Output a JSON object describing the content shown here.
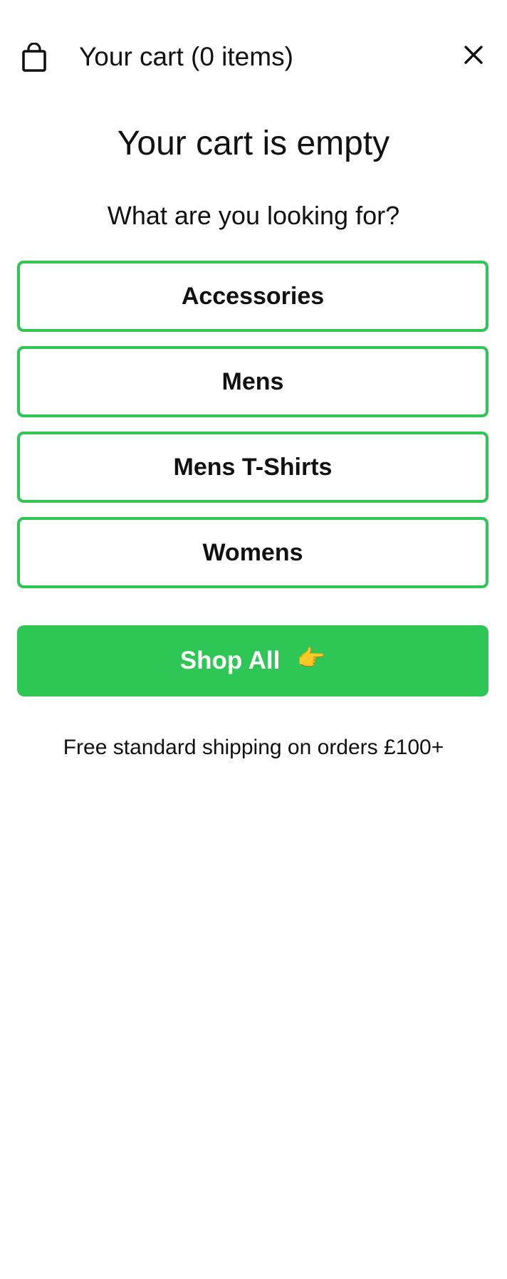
{
  "cart": {
    "title": "Your cart (0 items)",
    "empty_heading": "Your cart is empty",
    "prompt": "What are you looking for?",
    "categories": [
      {
        "label": "Accessories"
      },
      {
        "label": "Mens"
      },
      {
        "label": "Mens T-Shirts"
      },
      {
        "label": "Womens"
      }
    ],
    "shop_all_label": "Shop All",
    "shop_all_emoji": "👉",
    "shipping_note": "Free standard shipping on orders £100+"
  },
  "icons": {
    "bag": "shopping-bag-icon",
    "close": "close-icon",
    "pointing": "pointing-hand-icon"
  },
  "colors": {
    "accent": "#2ec654",
    "text": "#111111",
    "background": "#ffffff"
  }
}
